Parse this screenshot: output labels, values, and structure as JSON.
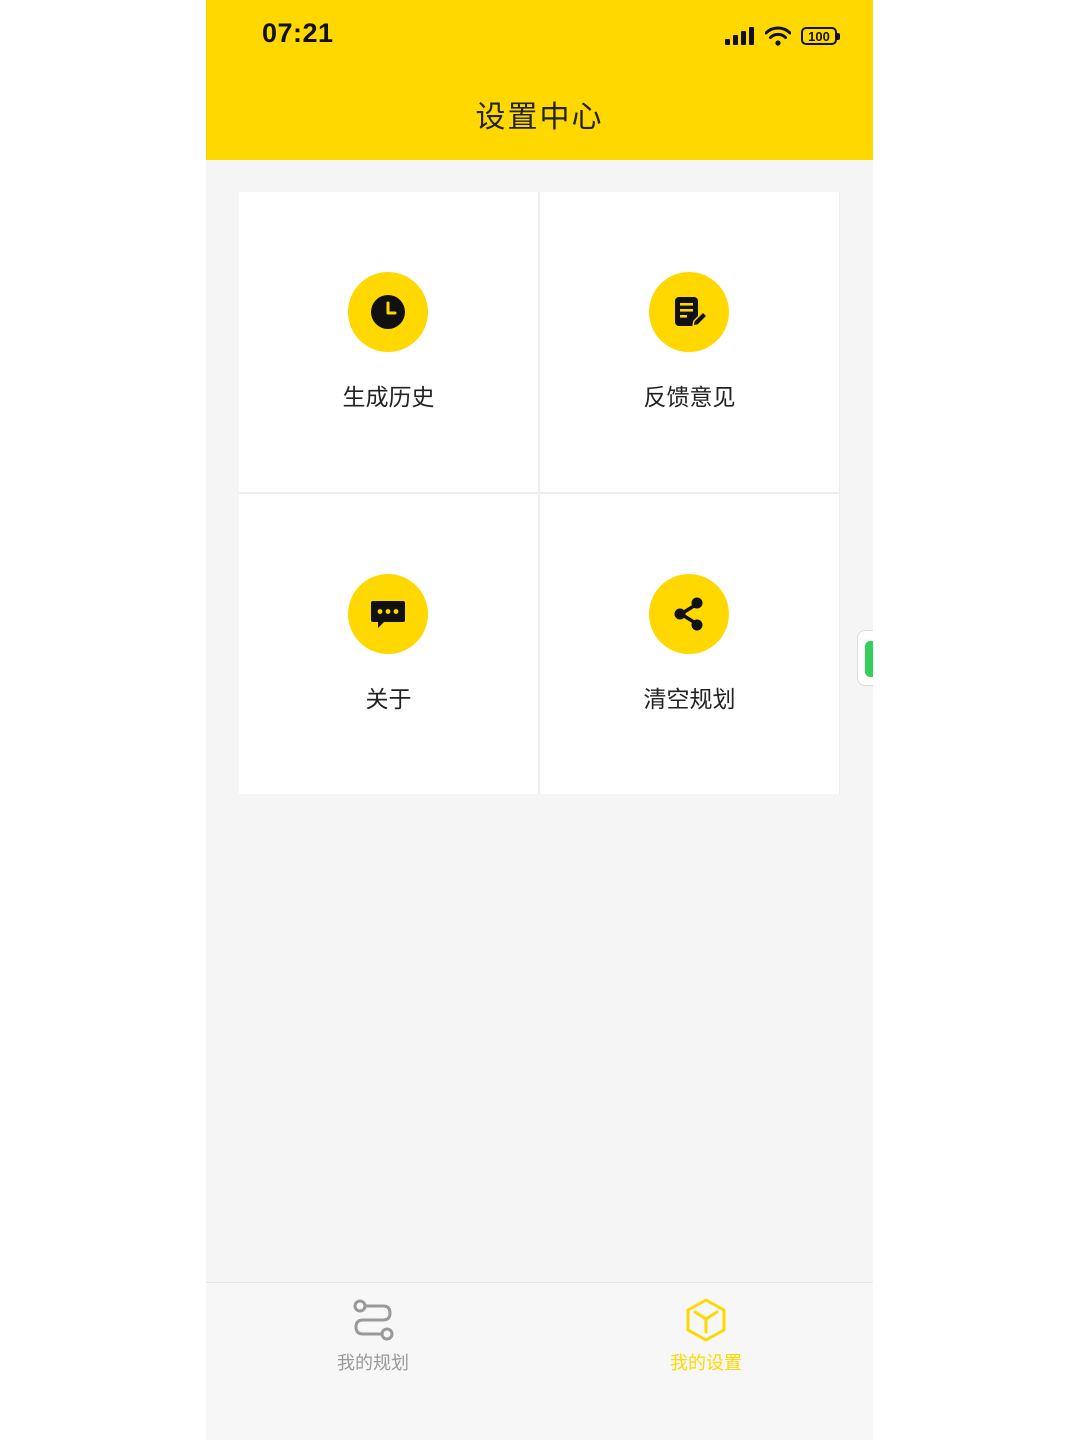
{
  "status_bar": {
    "time": "07:21",
    "battery": "100"
  },
  "header": {
    "title": "设置中心",
    "background_color": "#FFD800"
  },
  "settings_grid": {
    "tiles": [
      {
        "label": "生成历史",
        "icon": "clock-icon"
      },
      {
        "label": "反馈意见",
        "icon": "note-edit-icon"
      },
      {
        "label": "关于",
        "icon": "chat-bubble-icon"
      },
      {
        "label": "清空规划",
        "icon": "share-icon"
      }
    ]
  },
  "tab_bar": {
    "tabs": [
      {
        "label": "我的规划",
        "icon": "route-icon",
        "active": false,
        "color": "#999999"
      },
      {
        "label": "我的设置",
        "icon": "cube-icon",
        "active": true,
        "color": "#FFD800"
      }
    ]
  }
}
